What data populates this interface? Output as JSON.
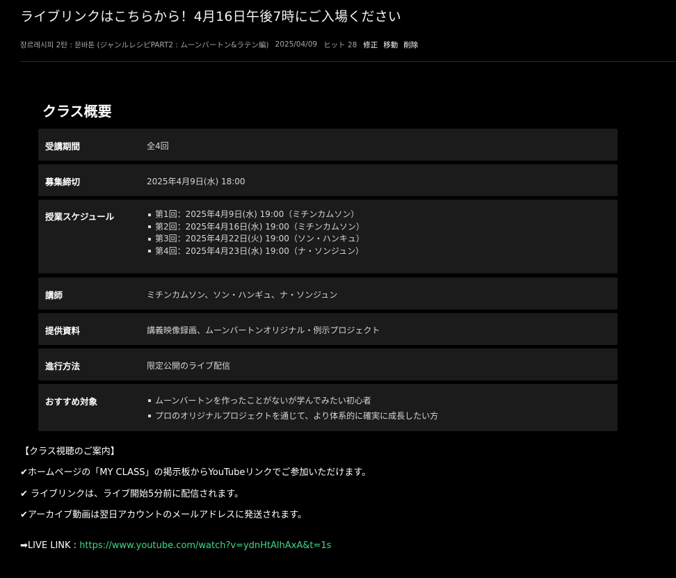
{
  "post": {
    "title": "ライブリンクはこちらから！4月16日午後7時にご入場ください",
    "category": "장르레시피 2탄 : 문바톤 (ジャンルレシピPART2 : ムーンバートン&ラテン編)",
    "date": "2025/04/09",
    "hits_label": "ヒット",
    "hits": "28",
    "actions": {
      "edit": "修正",
      "move": "移動",
      "delete": "削除"
    }
  },
  "class_overview": {
    "heading": "クラス概要",
    "rows": [
      {
        "label": "受講期間",
        "value": "全4回"
      },
      {
        "label": "募集締切",
        "value": "2025年4月9日(水) 18:00"
      },
      {
        "label": "授業スケジュール",
        "items": [
          "第1回：2025年4月9日(水) 19:00（ミチンカムソン）",
          "第2回：2025年4月16日(水) 19:00（ミチンカムソン）",
          "第3回：2025年4月22日(火) 19:00（ソン・ハンキュ）",
          "第4回：2025年4月23日(水) 19:00（ナ・ソンジュン）"
        ]
      },
      {
        "label": "講師",
        "value": "ミチンカムソン、ソン・ハンギュ、ナ・ソンジュン"
      },
      {
        "label": "提供資料",
        "value": "講義映像録画、ムーンバートンオリジナル・例示プロジェクト"
      },
      {
        "label": "進行方法",
        "value": "限定公開のライブ配信"
      },
      {
        "label": "おすすめ対象",
        "items": [
          "ムーンバートンを作ったことがないが学んでみたい初心者",
          "プロのオリジナルプロジェクトを通じて、より体系的に確実に成長したい方"
        ]
      }
    ]
  },
  "guide": {
    "heading": "【クラス視聴のご案内】",
    "lines": [
      "✔ホームページの「MY CLASS」の掲示板からYouTubeリンクでご参加いただけます。",
      "✔ ライブリンクは、ライブ開始5分前に配信されます。",
      "✔アーカイブ動画は翌日アカウントのメールアドレスに発送されます。"
    ],
    "live_prefix": "➡LIVE LINK : ",
    "live_url": "https://www.youtube.com/watch?v=ydnHtAlhAxA&t=1s"
  },
  "colors": {
    "background": "#000000",
    "row_background": "#1b1b1b",
    "link": "#3ddc84"
  }
}
